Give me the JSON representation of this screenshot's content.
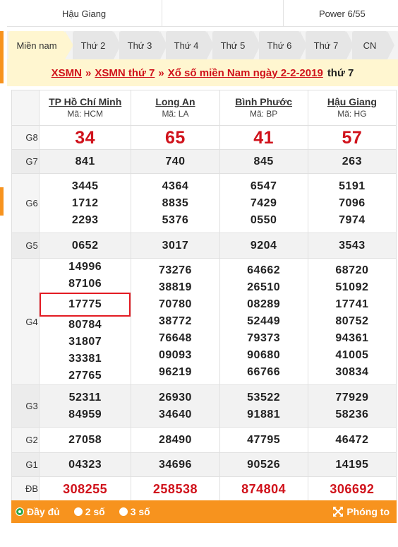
{
  "topbar": {
    "province": "Hậu Giang",
    "middle": "",
    "power": "Power 6/55"
  },
  "tabs": [
    "Miền nam",
    "Thứ 2",
    "Thứ 3",
    "Thứ 4",
    "Thứ 5",
    "Thứ 6",
    "Thứ 7",
    "CN"
  ],
  "breadcrumb": {
    "a1": "XSMN",
    "sep": "»",
    "a2": "XSMN thứ 7",
    "a3": "Xổ số miền Nam ngày 2-2-2019",
    "tail": "thứ 7"
  },
  "provinces": [
    {
      "name": "TP Hồ Chí Minh",
      "code": "Mã: HCM"
    },
    {
      "name": "Long An",
      "code": "Mã: LA"
    },
    {
      "name": "Bình Phước",
      "code": "Mã: BP"
    },
    {
      "name": "Hậu Giang",
      "code": "Mã: HG"
    }
  ],
  "prizes": {
    "g8": {
      "label": "G8",
      "v": [
        "34",
        "65",
        "41",
        "57"
      ]
    },
    "g7": {
      "label": "G7",
      "v": [
        "841",
        "740",
        "845",
        "263"
      ]
    },
    "g6": {
      "label": "G6",
      "v": [
        [
          "3445",
          "1712",
          "2293"
        ],
        [
          "4364",
          "8835",
          "5376"
        ],
        [
          "6547",
          "7429",
          "0550"
        ],
        [
          "5191",
          "7096",
          "7974"
        ]
      ]
    },
    "g5": {
      "label": "G5",
      "v": [
        "0652",
        "3017",
        "9204",
        "3543"
      ]
    },
    "g4": {
      "label": "G4",
      "v": [
        [
          "14996",
          "87106",
          "17775",
          "80784",
          "31807",
          "33381",
          "27765"
        ],
        [
          "73276",
          "38819",
          "70780",
          "38772",
          "76648",
          "09093",
          "96219"
        ],
        [
          "64662",
          "26510",
          "08289",
          "52449",
          "79373",
          "90680",
          "66766"
        ],
        [
          "68720",
          "51092",
          "17741",
          "80752",
          "94361",
          "41005",
          "30834"
        ]
      ]
    },
    "g3": {
      "label": "G3",
      "v": [
        [
          "52311",
          "84959"
        ],
        [
          "26930",
          "34640"
        ],
        [
          "53522",
          "91881"
        ],
        [
          "77929",
          "58236"
        ]
      ]
    },
    "g2": {
      "label": "G2",
      "v": [
        "27058",
        "28490",
        "47795",
        "46472"
      ]
    },
    "g1": {
      "label": "G1",
      "v": [
        "04323",
        "34696",
        "90526",
        "14195"
      ]
    },
    "db": {
      "label": "ĐB",
      "v": [
        "308255",
        "258538",
        "874804",
        "306692"
      ]
    }
  },
  "footer": {
    "opt_full": "Đầy đủ",
    "opt_2": "2 số",
    "opt_3": "3 số",
    "zoom": "Phóng to"
  },
  "colors": {
    "accent": "#f7931e",
    "red": "#d0121b",
    "banner_bg": "#fff6d0"
  },
  "icons": {
    "zoom": "expand-arrows-icon"
  }
}
